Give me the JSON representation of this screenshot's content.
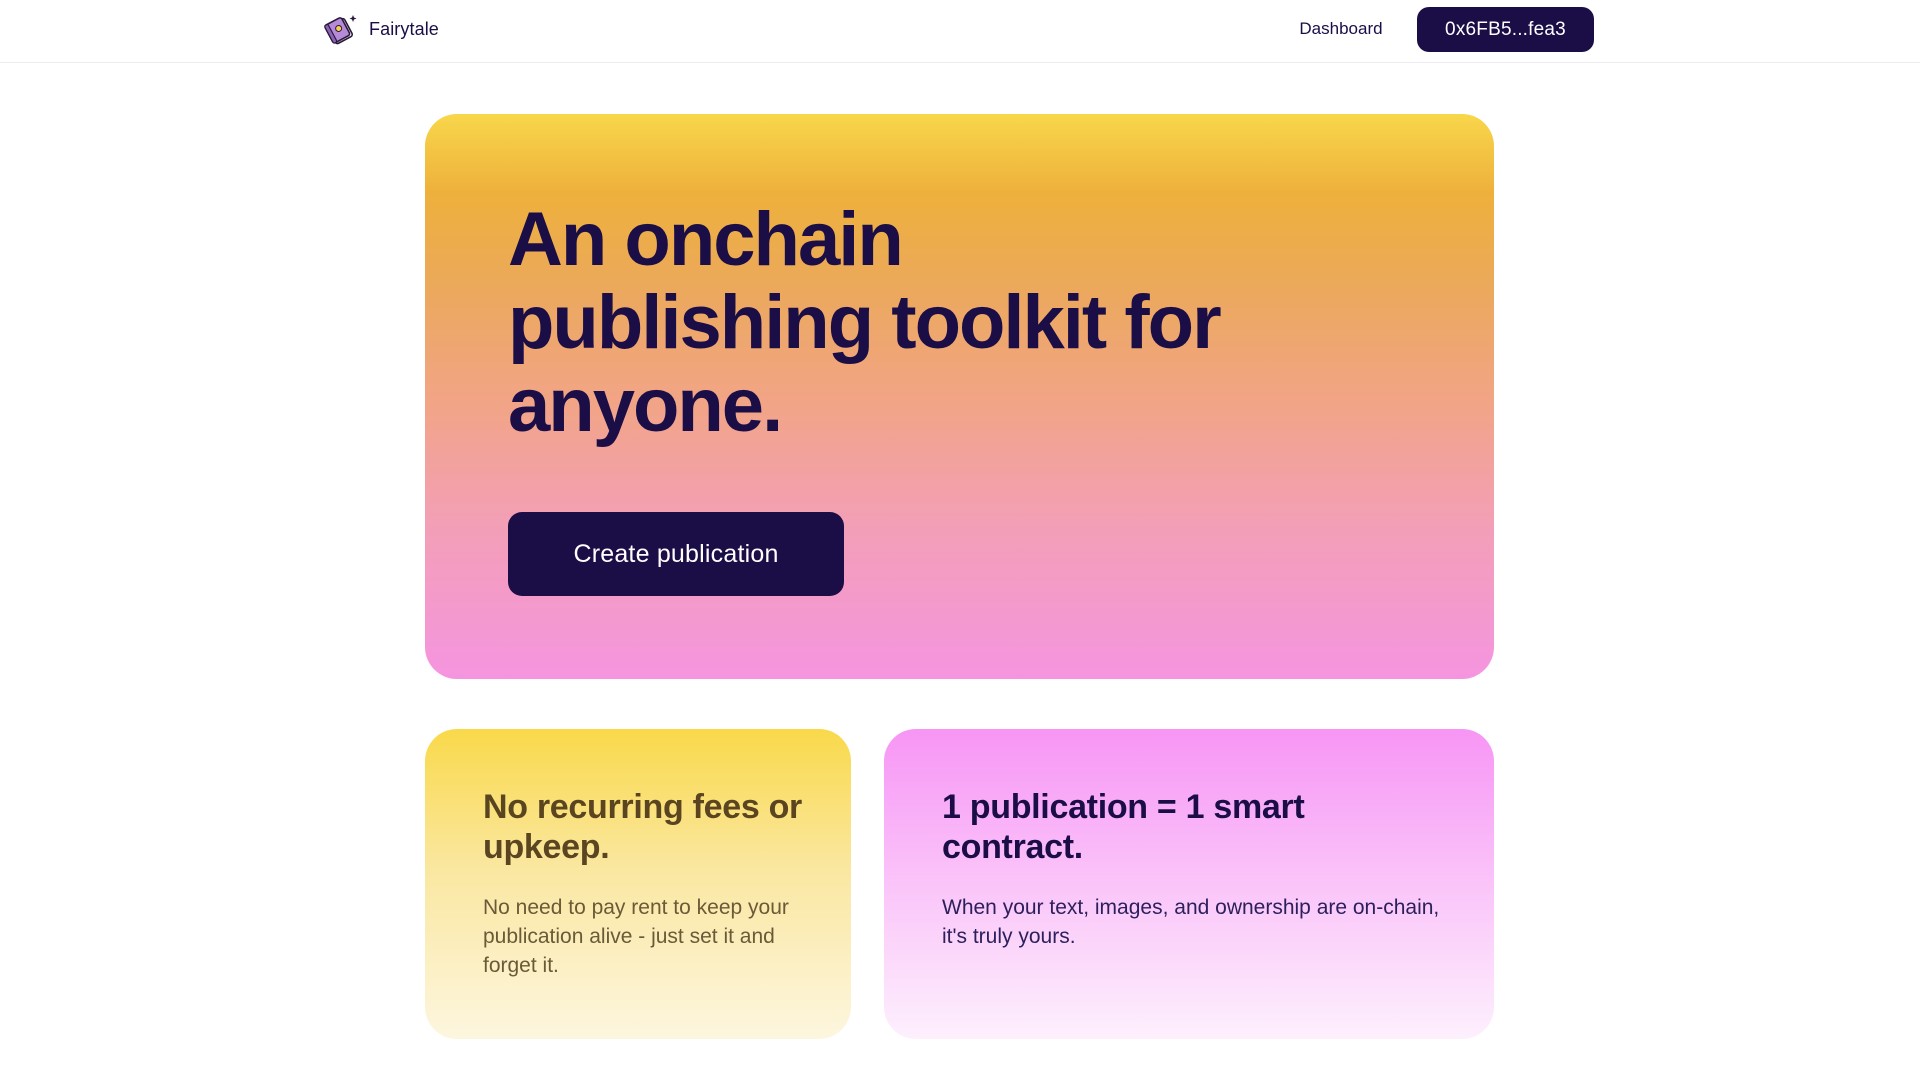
{
  "header": {
    "brand_name": "Fairytale",
    "logo_icon": "book-icon",
    "nav_dashboard": "Dashboard",
    "wallet_address": "0x6FB5...fea3"
  },
  "hero": {
    "title": "An onchain publishing toolkit for anyone.",
    "cta_label": "Create publication"
  },
  "features": [
    {
      "title": "No recurring fees or upkeep.",
      "body": "No need to pay rent to keep your publication alive - just set it and forget it."
    },
    {
      "title": "1 publication = 1 smart contract.",
      "body": "When your text, images, and ownership are on-chain, it's truly yours."
    }
  ],
  "colors": {
    "primary": "#1b0e47",
    "hero_gradient_top": "#f8d74a",
    "hero_gradient_bottom": "#f595e0",
    "yellow_card_top": "#f9d94a",
    "pink_card_top": "#f795f5"
  }
}
